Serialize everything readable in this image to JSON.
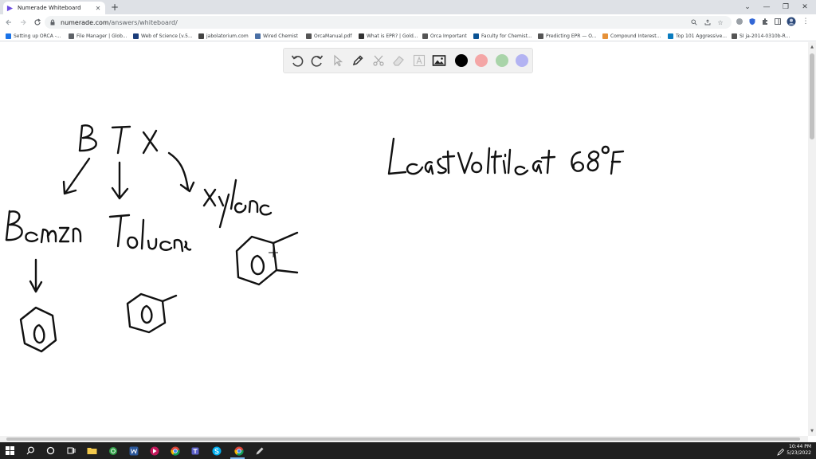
{
  "browser": {
    "tab": {
      "title": "Numerade Whiteboard"
    },
    "new_tab_symbol": "+",
    "url_host": "numerade.com",
    "url_path": "/answers/whiteboard/",
    "bookmarks": [
      {
        "label": "Setting up ORCA -...",
        "color": "#1a73e8"
      },
      {
        "label": "File Manager | Glob...",
        "color": "#5f6368"
      },
      {
        "label": "Web of Science [v.5...",
        "color": "#1b3d7a"
      },
      {
        "label": "jabolatorium.com",
        "color": "#444444"
      },
      {
        "label": "Wired Chemist",
        "color": "#4a6fa5"
      },
      {
        "label": "OrcaManual.pdf",
        "color": "#555555"
      },
      {
        "label": "What is EPR? | Gold...",
        "color": "#333333"
      },
      {
        "label": "Orca Important",
        "color": "#555555"
      },
      {
        "label": "Faculty for Chemist...",
        "color": "#0b5394"
      },
      {
        "label": "Predicting EPR — O...",
        "color": "#555555"
      },
      {
        "label": "Compound Interest...",
        "color": "#e69138"
      },
      {
        "label": "Top 101 Aggressive...",
        "color": "#0a7cbf"
      },
      {
        "label": "SI ja-2014-0310b-R...",
        "color": "#555555"
      }
    ]
  },
  "whiteboard": {
    "colors": {
      "black": "#000000",
      "red": "#f4a6a6",
      "green": "#a9d4a9",
      "purple": "#b3b3f2"
    },
    "tools": [
      "undo-icon",
      "redo-icon",
      "pointer-icon",
      "pen-icon",
      "scissors-icon",
      "eraser-icon",
      "text-icon",
      "image-icon"
    ]
  },
  "taskbar": {
    "time": "10:44 PM",
    "date": "5/23/2022"
  }
}
